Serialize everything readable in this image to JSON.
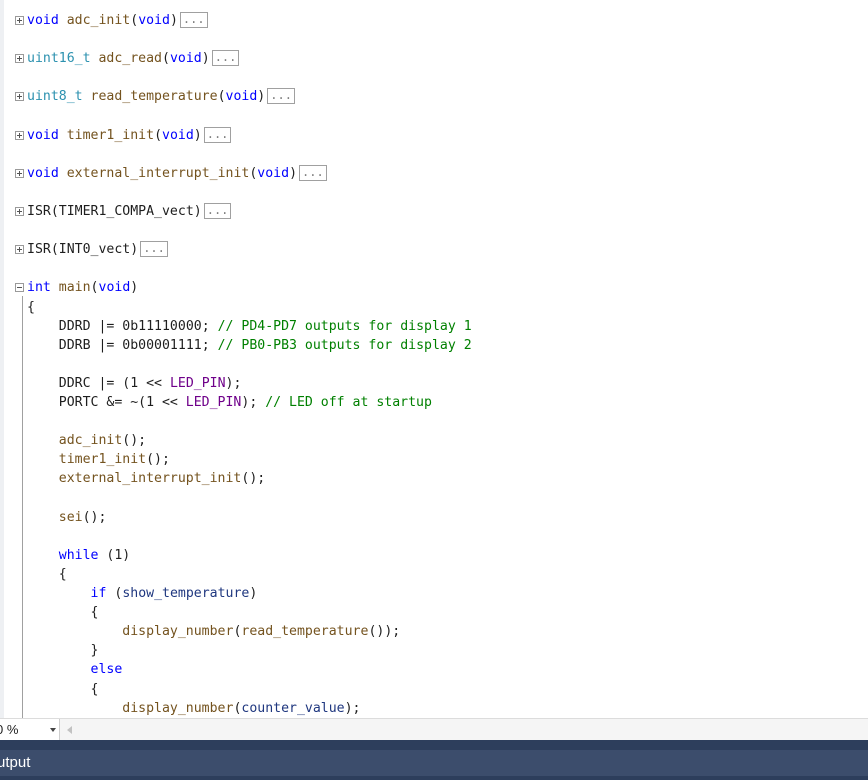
{
  "editor": {
    "lines": [
      [
        {
          "t": "void",
          "c": "kw"
        },
        {
          "t": " ",
          "c": "default"
        },
        {
          "t": "adc_init",
          "c": "fn"
        },
        {
          "t": "(",
          "c": "default"
        },
        {
          "t": "void",
          "c": "kw"
        },
        {
          "t": ")",
          "c": "default"
        }
      ],
      [],
      [
        {
          "t": "uint16_t",
          "c": "type"
        },
        {
          "t": " ",
          "c": "default"
        },
        {
          "t": "adc_read",
          "c": "fn"
        },
        {
          "t": "(",
          "c": "default"
        },
        {
          "t": "void",
          "c": "kw"
        },
        {
          "t": ")",
          "c": "default"
        }
      ],
      [],
      [
        {
          "t": "uint8_t",
          "c": "type"
        },
        {
          "t": " ",
          "c": "default"
        },
        {
          "t": "read_temperature",
          "c": "fn"
        },
        {
          "t": "(",
          "c": "default"
        },
        {
          "t": "void",
          "c": "kw"
        },
        {
          "t": ")",
          "c": "default"
        }
      ],
      [],
      [
        {
          "t": "void",
          "c": "kw"
        },
        {
          "t": " ",
          "c": "default"
        },
        {
          "t": "timer1_init",
          "c": "fn"
        },
        {
          "t": "(",
          "c": "default"
        },
        {
          "t": "void",
          "c": "kw"
        },
        {
          "t": ")",
          "c": "default"
        }
      ],
      [],
      [
        {
          "t": "void",
          "c": "kw"
        },
        {
          "t": " ",
          "c": "default"
        },
        {
          "t": "external_interrupt_init",
          "c": "fn"
        },
        {
          "t": "(",
          "c": "default"
        },
        {
          "t": "void",
          "c": "kw"
        },
        {
          "t": ")",
          "c": "default"
        }
      ],
      [],
      [
        {
          "t": "ISR",
          "c": "default"
        },
        {
          "t": "(",
          "c": "default"
        },
        {
          "t": "TIMER1_COMPA_vect",
          "c": "default"
        },
        {
          "t": ")",
          "c": "default"
        }
      ],
      [],
      [
        {
          "t": "ISR",
          "c": "default"
        },
        {
          "t": "(",
          "c": "default"
        },
        {
          "t": "INT0_vect",
          "c": "default"
        },
        {
          "t": ")",
          "c": "default"
        }
      ],
      [],
      [
        {
          "t": "int",
          "c": "kw"
        },
        {
          "t": " ",
          "c": "default"
        },
        {
          "t": "main",
          "c": "fn"
        },
        {
          "t": "(",
          "c": "default"
        },
        {
          "t": "void",
          "c": "kw"
        },
        {
          "t": ")",
          "c": "default"
        }
      ],
      [
        {
          "t": "{",
          "c": "default"
        }
      ],
      [
        {
          "t": "    DDRD ",
          "c": "default"
        },
        {
          "t": "|=",
          "c": "default"
        },
        {
          "t": " 0b11110000; ",
          "c": "default"
        },
        {
          "t": "// PD4-PD7 outputs for display 1",
          "c": "cm"
        }
      ],
      [
        {
          "t": "    DDRB ",
          "c": "default"
        },
        {
          "t": "|=",
          "c": "default"
        },
        {
          "t": " 0b00001111; ",
          "c": "default"
        },
        {
          "t": "// PB0-PB3 outputs for display 2",
          "c": "cm"
        }
      ],
      [],
      [
        {
          "t": "    DDRC ",
          "c": "default"
        },
        {
          "t": "|=",
          "c": "default"
        },
        {
          "t": " (1 << ",
          "c": "default"
        },
        {
          "t": "LED_PIN",
          "c": "macro"
        },
        {
          "t": ");",
          "c": "default"
        }
      ],
      [
        {
          "t": "    PORTC &= ~(1 << ",
          "c": "default"
        },
        {
          "t": "LED_PIN",
          "c": "macro"
        },
        {
          "t": "); ",
          "c": "default"
        },
        {
          "t": "// LED off at startup",
          "c": "cm"
        }
      ],
      [],
      [
        {
          "t": "    ",
          "c": "default"
        },
        {
          "t": "adc_init",
          "c": "fn"
        },
        {
          "t": "();",
          "c": "default"
        }
      ],
      [
        {
          "t": "    ",
          "c": "default"
        },
        {
          "t": "timer1_init",
          "c": "fn"
        },
        {
          "t": "();",
          "c": "default"
        }
      ],
      [
        {
          "t": "    ",
          "c": "default"
        },
        {
          "t": "external_interrupt_init",
          "c": "fn"
        },
        {
          "t": "();",
          "c": "default"
        }
      ],
      [],
      [
        {
          "t": "    ",
          "c": "default"
        },
        {
          "t": "sei",
          "c": "fn"
        },
        {
          "t": "();",
          "c": "default"
        }
      ],
      [],
      [
        {
          "t": "    ",
          "c": "default"
        },
        {
          "t": "while",
          "c": "kw"
        },
        {
          "t": " (1)",
          "c": "default"
        }
      ],
      [
        {
          "t": "    {",
          "c": "default"
        }
      ],
      [
        {
          "t": "        ",
          "c": "default"
        },
        {
          "t": "if",
          "c": "kw"
        },
        {
          "t": " (",
          "c": "default"
        },
        {
          "t": "show_temperature",
          "c": "var"
        },
        {
          "t": ")",
          "c": "default"
        }
      ],
      [
        {
          "t": "        {",
          "c": "default"
        }
      ],
      [
        {
          "t": "            ",
          "c": "default"
        },
        {
          "t": "display_number",
          "c": "fn"
        },
        {
          "t": "(",
          "c": "default"
        },
        {
          "t": "read_temperature",
          "c": "fn"
        },
        {
          "t": "());",
          "c": "default"
        }
      ],
      [
        {
          "t": "        }",
          "c": "default"
        }
      ],
      [
        {
          "t": "        ",
          "c": "default"
        },
        {
          "t": "else",
          "c": "kw"
        }
      ],
      [
        {
          "t": "        {",
          "c": "default"
        }
      ],
      [
        {
          "t": "            ",
          "c": "default"
        },
        {
          "t": "display_number",
          "c": "fn"
        },
        {
          "t": "(",
          "c": "default"
        },
        {
          "t": "counter_value",
          "c": "var"
        },
        {
          "t": ");",
          "c": "default"
        }
      ]
    ],
    "collapsed_indicator": "...",
    "folds": [
      {
        "line": 0,
        "state": "collapsed"
      },
      {
        "line": 2,
        "state": "collapsed"
      },
      {
        "line": 4,
        "state": "collapsed"
      },
      {
        "line": 6,
        "state": "collapsed"
      },
      {
        "line": 8,
        "state": "collapsed"
      },
      {
        "line": 10,
        "state": "collapsed"
      },
      {
        "line": 12,
        "state": "collapsed"
      },
      {
        "line": 14,
        "state": "expanded"
      }
    ]
  },
  "status": {
    "zoom_label": "0 %"
  },
  "output_panel": {
    "title": "utput"
  },
  "colors": {
    "keyword": "#0000ff",
    "type": "#2b91af",
    "function": "#74531f",
    "macro": "#6f008a",
    "comment": "#008000",
    "variable": "#1f377f",
    "output_bar": "#3c4d6c"
  }
}
